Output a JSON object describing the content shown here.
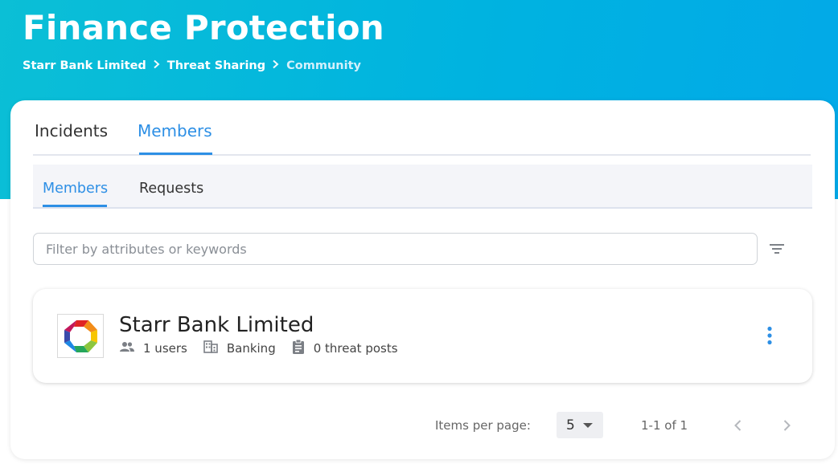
{
  "header": {
    "title": "Finance Protection",
    "breadcrumb": [
      "Starr Bank Limited",
      "Threat Sharing",
      "Community"
    ]
  },
  "tabs": [
    {
      "label": "Incidents",
      "active": false
    },
    {
      "label": "Members",
      "active": true
    }
  ],
  "subtabs": [
    {
      "label": "Members",
      "active": true
    },
    {
      "label": "Requests",
      "active": false
    }
  ],
  "filter": {
    "placeholder": "Filter by attributes or keywords",
    "value": "",
    "icon": "filter-list-icon"
  },
  "members": [
    {
      "name": "Starr Bank Limited",
      "users": "1 users",
      "sector": "Banking",
      "threat_posts": "0 threat posts"
    }
  ],
  "pagination": {
    "items_per_page_label": "Items per page:",
    "items_per_page": "5",
    "range": "1-1 of 1"
  },
  "colors": {
    "accent": "#2d8fe5",
    "hero_start": "#0bbfd6",
    "hero_end": "#02a9e8"
  }
}
